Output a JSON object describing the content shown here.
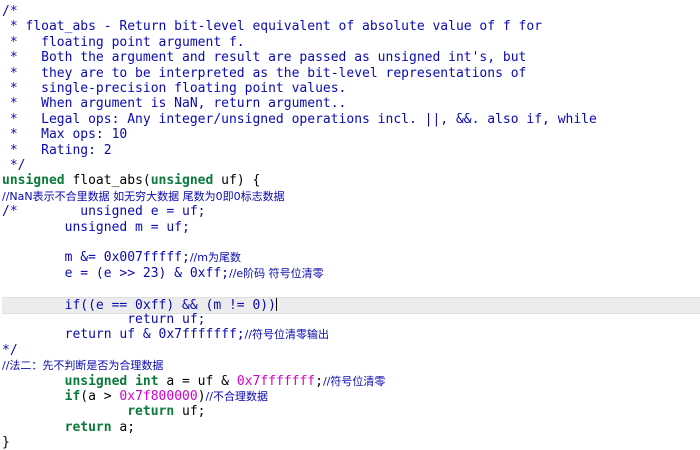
{
  "editor": {
    "lines": [
      {
        "segs": [
          {
            "c": "cm",
            "t": "/*"
          }
        ]
      },
      {
        "segs": [
          {
            "c": "cm",
            "t": " * float_abs - Return bit-level equivalent of absolute value of f for"
          }
        ]
      },
      {
        "segs": [
          {
            "c": "cm",
            "t": " *   floating point argument f."
          }
        ]
      },
      {
        "segs": [
          {
            "c": "cm",
            "t": " *   Both the argument and result are passed as unsigned int's, but"
          }
        ]
      },
      {
        "segs": [
          {
            "c": "cm",
            "t": " *   they are to be interpreted as the bit-level representations of"
          }
        ]
      },
      {
        "segs": [
          {
            "c": "cm",
            "t": " *   single-precision floating point values."
          }
        ]
      },
      {
        "segs": [
          {
            "c": "cm",
            "t": " *   When argument is NaN, return argument.."
          }
        ]
      },
      {
        "segs": [
          {
            "c": "cm",
            "t": " *   Legal ops: Any integer/unsigned operations incl. ||, &&. also if, while"
          }
        ]
      },
      {
        "segs": [
          {
            "c": "cm",
            "t": " *   Max ops: 10"
          }
        ]
      },
      {
        "segs": [
          {
            "c": "cm",
            "t": " *   Rating: 2"
          }
        ]
      },
      {
        "segs": [
          {
            "c": "cm",
            "t": " */"
          }
        ]
      },
      {
        "segs": [
          {
            "c": "kw",
            "t": "unsigned"
          },
          {
            "c": "",
            "t": " float_abs("
          },
          {
            "c": "kw",
            "t": "unsigned"
          },
          {
            "c": "",
            "t": " uf) {"
          }
        ]
      },
      {
        "segs": [
          {
            "c": "cm cjk",
            "t": "//NaN表示不合里数据 如无穷大数据 尾数为0即0标志数据"
          }
        ]
      },
      {
        "segs": [
          {
            "c": "cm",
            "t": "/*        unsigned e = uf;"
          }
        ]
      },
      {
        "segs": [
          {
            "c": "cm",
            "t": "        unsigned m = uf;"
          }
        ]
      },
      {
        "segs": [
          {
            "c": "cm",
            "t": ""
          }
        ]
      },
      {
        "segs": [
          {
            "c": "cm",
            "t": "        m &= 0x007fffff;"
          },
          {
            "c": "cm cjk",
            "t": "//m为尾数"
          }
        ]
      },
      {
        "segs": [
          {
            "c": "cm",
            "t": "        e = (e >> 23) & 0xff;"
          },
          {
            "c": "cm cjk",
            "t": "//e阶码 符号位清零"
          }
        ]
      },
      {
        "segs": [
          {
            "c": "cm",
            "t": ""
          }
        ]
      },
      {
        "segs": [
          {
            "c": "cm",
            "t": "        if((e == 0xff) && (m != 0))"
          }
        ],
        "current": true
      },
      {
        "segs": [
          {
            "c": "cm",
            "t": "                return uf;"
          }
        ]
      },
      {
        "segs": [
          {
            "c": "cm",
            "t": "        return uf & 0x7fffffff;"
          },
          {
            "c": "cm cjk",
            "t": "//符号位清零输出"
          }
        ]
      },
      {
        "segs": [
          {
            "c": "cm",
            "t": "*/"
          }
        ]
      },
      {
        "segs": [
          {
            "c": "cm cjk",
            "t": "//法二：先不判断是否为合理数据"
          }
        ]
      },
      {
        "segs": [
          {
            "c": "",
            "t": "        "
          },
          {
            "c": "kw",
            "t": "unsigned int"
          },
          {
            "c": "",
            "t": " a = uf & "
          },
          {
            "c": "nm",
            "t": "0x7fffffff"
          },
          {
            "c": "",
            "t": ";"
          },
          {
            "c": "cm cjk",
            "t": "//符号位清零"
          }
        ]
      },
      {
        "segs": [
          {
            "c": "",
            "t": "        "
          },
          {
            "c": "kw",
            "t": "if"
          },
          {
            "c": "",
            "t": "(a > "
          },
          {
            "c": "nm",
            "t": "0x7f800000"
          },
          {
            "c": "",
            "t": ")"
          },
          {
            "c": "cm cjk",
            "t": "//不合理数据"
          }
        ]
      },
      {
        "segs": [
          {
            "c": "",
            "t": "                "
          },
          {
            "c": "kw",
            "t": "return"
          },
          {
            "c": "",
            "t": " uf;"
          }
        ]
      },
      {
        "segs": [
          {
            "c": "",
            "t": "        "
          },
          {
            "c": "kw",
            "t": "return"
          },
          {
            "c": "",
            "t": " a;"
          }
        ]
      },
      {
        "segs": [
          {
            "c": "",
            "t": "}"
          }
        ]
      }
    ]
  }
}
